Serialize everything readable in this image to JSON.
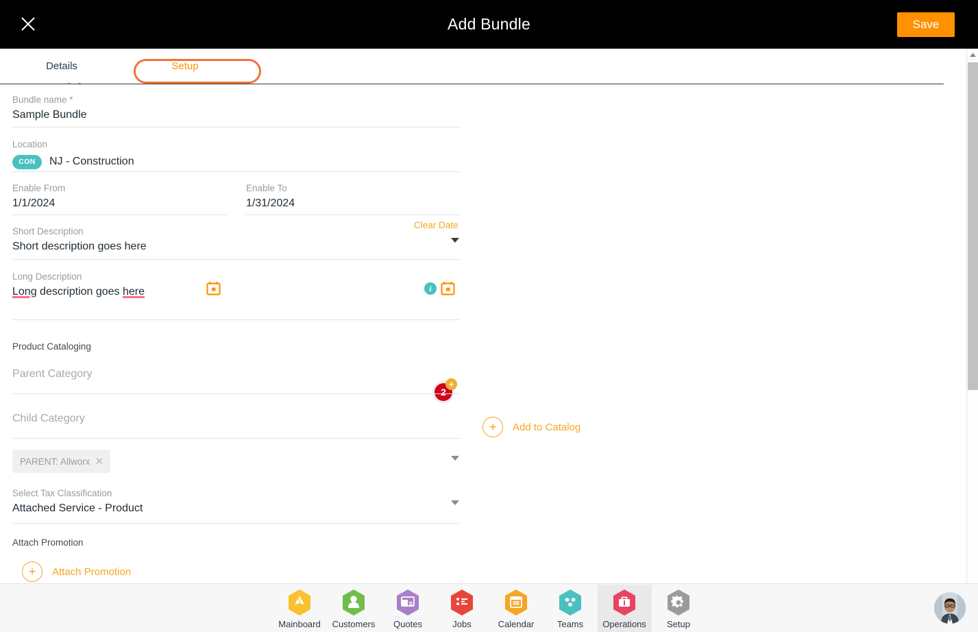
{
  "header": {
    "title": "Add Bundle",
    "close_icon": "close-icon",
    "save_label": "Save"
  },
  "tabs": [
    {
      "label": "Details",
      "active": true
    },
    {
      "label": "Setup",
      "active": false,
      "highlighted": true
    }
  ],
  "form": {
    "bundle_name": {
      "label": "Bundle name *",
      "value": "Sample Bundle"
    },
    "location": {
      "label": "Location",
      "chip": "CON",
      "value": "NJ - Construction"
    },
    "enable_from": {
      "label": "Enable From",
      "value": "1/1/2024",
      "icon": "calendar-icon"
    },
    "enable_to": {
      "label": "Enable To",
      "value": "1/31/2024",
      "icon": "calendar-icon",
      "info_icon": "info-icon",
      "clear_label": "Clear Date"
    },
    "short_description": {
      "label": "Short Description",
      "value": "Short description goes here"
    },
    "long_description": {
      "label": "Long Description",
      "value_parts": [
        "Long",
        " description goes ",
        "here"
      ],
      "badge_count": "2",
      "badge_plus": "+"
    },
    "product_cataloging": {
      "label": "Product Cataloging"
    },
    "parent_category": {
      "label": "Parent Category",
      "placeholder": "Parent Category",
      "value": ""
    },
    "child_category": {
      "label": "Child Category",
      "placeholder": "Child Category",
      "value": ""
    },
    "add_to_catalog": {
      "label": "Add to Catalog",
      "icon": "plus-circle-icon"
    },
    "parent_chip": {
      "label": "PARENT: Allworx",
      "remove_icon": "close-icon"
    },
    "tax_classification": {
      "label": "Select Tax Classification",
      "value": "Attached Service - Product"
    },
    "attach_promotion_label": "Attach Promotion",
    "attach_promotion_button": {
      "label": "Attach Promotion",
      "icon": "plus-circle-icon"
    }
  },
  "scrollbar": {
    "up_icon": "chevron-up-icon",
    "down_icon": "chevron-down-icon"
  },
  "footer": {
    "nav": [
      {
        "label": "Mainboard",
        "icon": "mainboard-icon",
        "color": "#F7C22E",
        "active": false
      },
      {
        "label": "Customers",
        "icon": "customers-icon",
        "color": "#6FBE4A",
        "active": false
      },
      {
        "label": "Quotes",
        "icon": "quotes-icon",
        "color": "#A97FC9",
        "active": false
      },
      {
        "label": "Jobs",
        "icon": "jobs-icon",
        "color": "#E8453C",
        "active": false
      },
      {
        "label": "Calendar",
        "icon": "calendar-icon",
        "color": "#F5A623",
        "active": false
      },
      {
        "label": "Teams",
        "icon": "teams-icon",
        "color": "#4BC0C0",
        "active": false
      },
      {
        "label": "Operations",
        "icon": "operations-icon",
        "color": "#E8445F",
        "active": true
      },
      {
        "label": "Setup",
        "icon": "gear-icon",
        "color": "#9B9B9B",
        "active": false
      }
    ],
    "avatar": "user-avatar"
  },
  "colors": {
    "accent_orange": "#FF9100",
    "highlight_orange": "#F4703A",
    "teal": "#4BC0C0",
    "badge_red": "#D0021B",
    "header_black": "#000000"
  }
}
